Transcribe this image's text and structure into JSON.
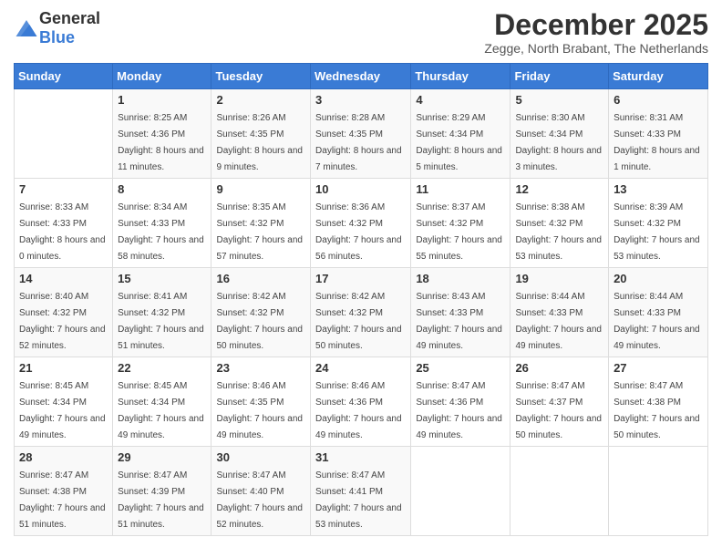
{
  "header": {
    "logo_general": "General",
    "logo_blue": "Blue",
    "month": "December 2025",
    "location": "Zegge, North Brabant, The Netherlands"
  },
  "weekdays": [
    "Sunday",
    "Monday",
    "Tuesday",
    "Wednesday",
    "Thursday",
    "Friday",
    "Saturday"
  ],
  "weeks": [
    [
      {
        "day": "",
        "sunrise": "",
        "sunset": "",
        "daylight": ""
      },
      {
        "day": "1",
        "sunrise": "Sunrise: 8:25 AM",
        "sunset": "Sunset: 4:36 PM",
        "daylight": "Daylight: 8 hours and 11 minutes."
      },
      {
        "day": "2",
        "sunrise": "Sunrise: 8:26 AM",
        "sunset": "Sunset: 4:35 PM",
        "daylight": "Daylight: 8 hours and 9 minutes."
      },
      {
        "day": "3",
        "sunrise": "Sunrise: 8:28 AM",
        "sunset": "Sunset: 4:35 PM",
        "daylight": "Daylight: 8 hours and 7 minutes."
      },
      {
        "day": "4",
        "sunrise": "Sunrise: 8:29 AM",
        "sunset": "Sunset: 4:34 PM",
        "daylight": "Daylight: 8 hours and 5 minutes."
      },
      {
        "day": "5",
        "sunrise": "Sunrise: 8:30 AM",
        "sunset": "Sunset: 4:34 PM",
        "daylight": "Daylight: 8 hours and 3 minutes."
      },
      {
        "day": "6",
        "sunrise": "Sunrise: 8:31 AM",
        "sunset": "Sunset: 4:33 PM",
        "daylight": "Daylight: 8 hours and 1 minute."
      }
    ],
    [
      {
        "day": "7",
        "sunrise": "Sunrise: 8:33 AM",
        "sunset": "Sunset: 4:33 PM",
        "daylight": "Daylight: 8 hours and 0 minutes."
      },
      {
        "day": "8",
        "sunrise": "Sunrise: 8:34 AM",
        "sunset": "Sunset: 4:33 PM",
        "daylight": "Daylight: 7 hours and 58 minutes."
      },
      {
        "day": "9",
        "sunrise": "Sunrise: 8:35 AM",
        "sunset": "Sunset: 4:32 PM",
        "daylight": "Daylight: 7 hours and 57 minutes."
      },
      {
        "day": "10",
        "sunrise": "Sunrise: 8:36 AM",
        "sunset": "Sunset: 4:32 PM",
        "daylight": "Daylight: 7 hours and 56 minutes."
      },
      {
        "day": "11",
        "sunrise": "Sunrise: 8:37 AM",
        "sunset": "Sunset: 4:32 PM",
        "daylight": "Daylight: 7 hours and 55 minutes."
      },
      {
        "day": "12",
        "sunrise": "Sunrise: 8:38 AM",
        "sunset": "Sunset: 4:32 PM",
        "daylight": "Daylight: 7 hours and 53 minutes."
      },
      {
        "day": "13",
        "sunrise": "Sunrise: 8:39 AM",
        "sunset": "Sunset: 4:32 PM",
        "daylight": "Daylight: 7 hours and 53 minutes."
      }
    ],
    [
      {
        "day": "14",
        "sunrise": "Sunrise: 8:40 AM",
        "sunset": "Sunset: 4:32 PM",
        "daylight": "Daylight: 7 hours and 52 minutes."
      },
      {
        "day": "15",
        "sunrise": "Sunrise: 8:41 AM",
        "sunset": "Sunset: 4:32 PM",
        "daylight": "Daylight: 7 hours and 51 minutes."
      },
      {
        "day": "16",
        "sunrise": "Sunrise: 8:42 AM",
        "sunset": "Sunset: 4:32 PM",
        "daylight": "Daylight: 7 hours and 50 minutes."
      },
      {
        "day": "17",
        "sunrise": "Sunrise: 8:42 AM",
        "sunset": "Sunset: 4:32 PM",
        "daylight": "Daylight: 7 hours and 50 minutes."
      },
      {
        "day": "18",
        "sunrise": "Sunrise: 8:43 AM",
        "sunset": "Sunset: 4:33 PM",
        "daylight": "Daylight: 7 hours and 49 minutes."
      },
      {
        "day": "19",
        "sunrise": "Sunrise: 8:44 AM",
        "sunset": "Sunset: 4:33 PM",
        "daylight": "Daylight: 7 hours and 49 minutes."
      },
      {
        "day": "20",
        "sunrise": "Sunrise: 8:44 AM",
        "sunset": "Sunset: 4:33 PM",
        "daylight": "Daylight: 7 hours and 49 minutes."
      }
    ],
    [
      {
        "day": "21",
        "sunrise": "Sunrise: 8:45 AM",
        "sunset": "Sunset: 4:34 PM",
        "daylight": "Daylight: 7 hours and 49 minutes."
      },
      {
        "day": "22",
        "sunrise": "Sunrise: 8:45 AM",
        "sunset": "Sunset: 4:34 PM",
        "daylight": "Daylight: 7 hours and 49 minutes."
      },
      {
        "day": "23",
        "sunrise": "Sunrise: 8:46 AM",
        "sunset": "Sunset: 4:35 PM",
        "daylight": "Daylight: 7 hours and 49 minutes."
      },
      {
        "day": "24",
        "sunrise": "Sunrise: 8:46 AM",
        "sunset": "Sunset: 4:36 PM",
        "daylight": "Daylight: 7 hours and 49 minutes."
      },
      {
        "day": "25",
        "sunrise": "Sunrise: 8:47 AM",
        "sunset": "Sunset: 4:36 PM",
        "daylight": "Daylight: 7 hours and 49 minutes."
      },
      {
        "day": "26",
        "sunrise": "Sunrise: 8:47 AM",
        "sunset": "Sunset: 4:37 PM",
        "daylight": "Daylight: 7 hours and 50 minutes."
      },
      {
        "day": "27",
        "sunrise": "Sunrise: 8:47 AM",
        "sunset": "Sunset: 4:38 PM",
        "daylight": "Daylight: 7 hours and 50 minutes."
      }
    ],
    [
      {
        "day": "28",
        "sunrise": "Sunrise: 8:47 AM",
        "sunset": "Sunset: 4:38 PM",
        "daylight": "Daylight: 7 hours and 51 minutes."
      },
      {
        "day": "29",
        "sunrise": "Sunrise: 8:47 AM",
        "sunset": "Sunset: 4:39 PM",
        "daylight": "Daylight: 7 hours and 51 minutes."
      },
      {
        "day": "30",
        "sunrise": "Sunrise: 8:47 AM",
        "sunset": "Sunset: 4:40 PM",
        "daylight": "Daylight: 7 hours and 52 minutes."
      },
      {
        "day": "31",
        "sunrise": "Sunrise: 8:47 AM",
        "sunset": "Sunset: 4:41 PM",
        "daylight": "Daylight: 7 hours and 53 minutes."
      },
      {
        "day": "",
        "sunrise": "",
        "sunset": "",
        "daylight": ""
      },
      {
        "day": "",
        "sunrise": "",
        "sunset": "",
        "daylight": ""
      },
      {
        "day": "",
        "sunrise": "",
        "sunset": "",
        "daylight": ""
      }
    ]
  ]
}
